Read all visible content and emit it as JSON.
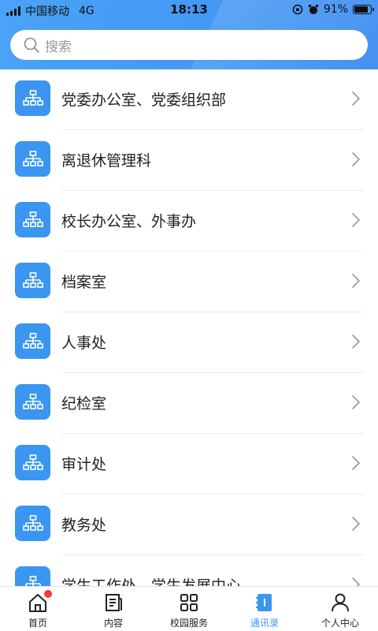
{
  "status_bar": {
    "carrier": "中国移动",
    "network": "4G",
    "time": "18:13",
    "battery": "91%",
    "battery_level": 0.91
  },
  "search": {
    "placeholder": "搜索"
  },
  "departments": [
    {
      "label": "党委办公室、党委组织部"
    },
    {
      "label": "离退休管理科"
    },
    {
      "label": "校长办公室、外事办"
    },
    {
      "label": "档案室"
    },
    {
      "label": "人事处"
    },
    {
      "label": "纪检室"
    },
    {
      "label": "审计处"
    },
    {
      "label": "教务处"
    },
    {
      "label": "学生工作处、学生发展中心"
    }
  ],
  "tabbar": {
    "items": [
      {
        "label": "首页",
        "icon": "home-icon"
      },
      {
        "label": "内容",
        "icon": "document-icon"
      },
      {
        "label": "校园服务",
        "icon": "grid-icon"
      },
      {
        "label": "通讯录",
        "icon": "contacts-book-icon"
      },
      {
        "label": "个人中心",
        "icon": "user-icon"
      }
    ],
    "active_index": 3
  },
  "colors": {
    "accent": "#3a96f0",
    "badge": "#f23b3b"
  }
}
